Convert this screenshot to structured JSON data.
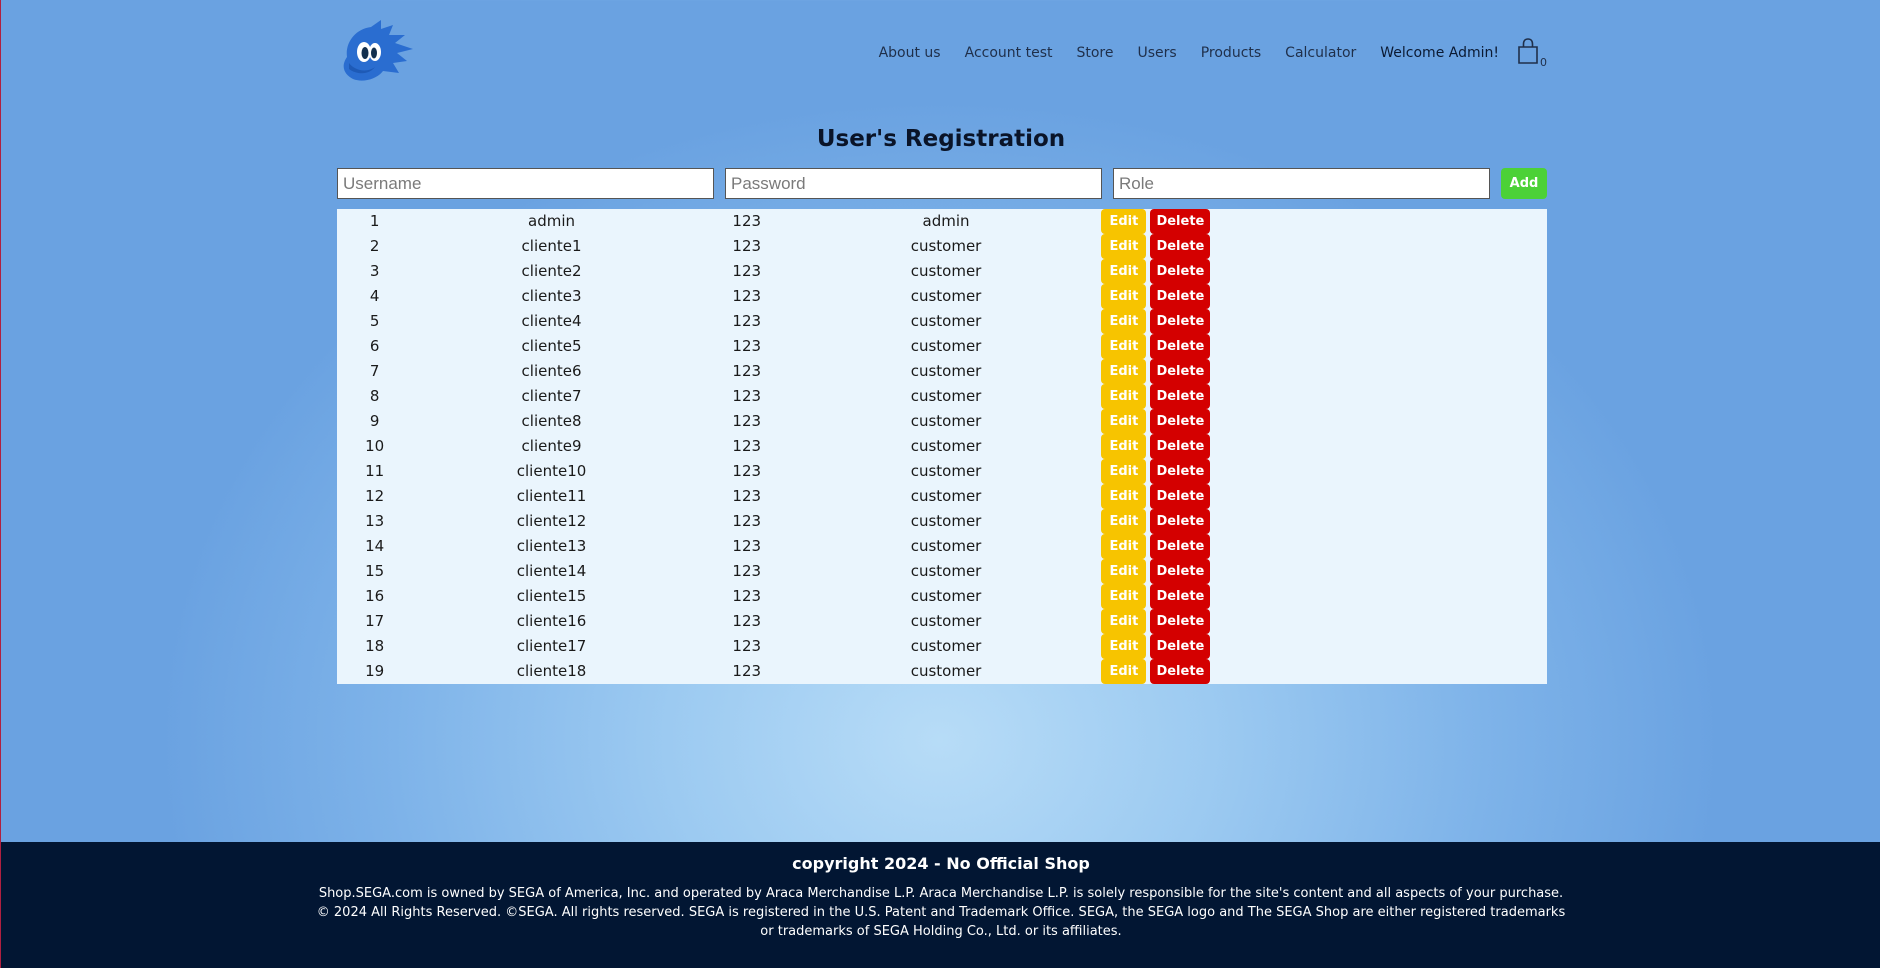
{
  "header": {
    "logo_icon": "hedgehog-logo-icon",
    "nav": [
      {
        "label": "About us"
      },
      {
        "label": "Account test"
      },
      {
        "label": "Store"
      },
      {
        "label": "Users"
      },
      {
        "label": "Products"
      },
      {
        "label": "Calculator"
      }
    ],
    "welcome": "Welcome Admin!",
    "cart_icon": "shopping-bag-icon",
    "cart_count": "0"
  },
  "page": {
    "title": "User's Registration"
  },
  "form": {
    "username_placeholder": "Username",
    "password_placeholder": "Password",
    "role_placeholder": "Role",
    "add_label": "Add"
  },
  "table": {
    "edit_label": "Edit",
    "delete_label": "Delete",
    "rows": [
      {
        "id": "1",
        "username": "admin",
        "password": "123",
        "role": "admin"
      },
      {
        "id": "2",
        "username": "cliente1",
        "password": "123",
        "role": "customer"
      },
      {
        "id": "3",
        "username": "cliente2",
        "password": "123",
        "role": "customer"
      },
      {
        "id": "4",
        "username": "cliente3",
        "password": "123",
        "role": "customer"
      },
      {
        "id": "5",
        "username": "cliente4",
        "password": "123",
        "role": "customer"
      },
      {
        "id": "6",
        "username": "cliente5",
        "password": "123",
        "role": "customer"
      },
      {
        "id": "7",
        "username": "cliente6",
        "password": "123",
        "role": "customer"
      },
      {
        "id": "8",
        "username": "cliente7",
        "password": "123",
        "role": "customer"
      },
      {
        "id": "9",
        "username": "cliente8",
        "password": "123",
        "role": "customer"
      },
      {
        "id": "10",
        "username": "cliente9",
        "password": "123",
        "role": "customer"
      },
      {
        "id": "11",
        "username": "cliente10",
        "password": "123",
        "role": "customer"
      },
      {
        "id": "12",
        "username": "cliente11",
        "password": "123",
        "role": "customer"
      },
      {
        "id": "13",
        "username": "cliente12",
        "password": "123",
        "role": "customer"
      },
      {
        "id": "14",
        "username": "cliente13",
        "password": "123",
        "role": "customer"
      },
      {
        "id": "15",
        "username": "cliente14",
        "password": "123",
        "role": "customer"
      },
      {
        "id": "16",
        "username": "cliente15",
        "password": "123",
        "role": "customer"
      },
      {
        "id": "17",
        "username": "cliente16",
        "password": "123",
        "role": "customer"
      },
      {
        "id": "18",
        "username": "cliente17",
        "password": "123",
        "role": "customer"
      },
      {
        "id": "19",
        "username": "cliente18",
        "password": "123",
        "role": "customer"
      }
    ]
  },
  "footer": {
    "title": "copyright 2024 - No Official Shop",
    "text": "Shop.SEGA.com is owned by SEGA of America, Inc. and operated by Araca Merchandise L.P. Araca Merchandise L.P. is solely responsible for the site's content and all aspects of your purchase. © 2024 All Rights Reserved. ©SEGA. All rights reserved. SEGA is registered in the U.S. Patent and Trademark Office. SEGA, the SEGA logo and The SEGA Shop are either registered trademarks or trademarks of SEGA Holding Co., Ltd. or its affiliates."
  },
  "colors": {
    "add": "#4cd137",
    "edit": "#f7c400",
    "delete": "#d40000",
    "footer": "#021633"
  }
}
